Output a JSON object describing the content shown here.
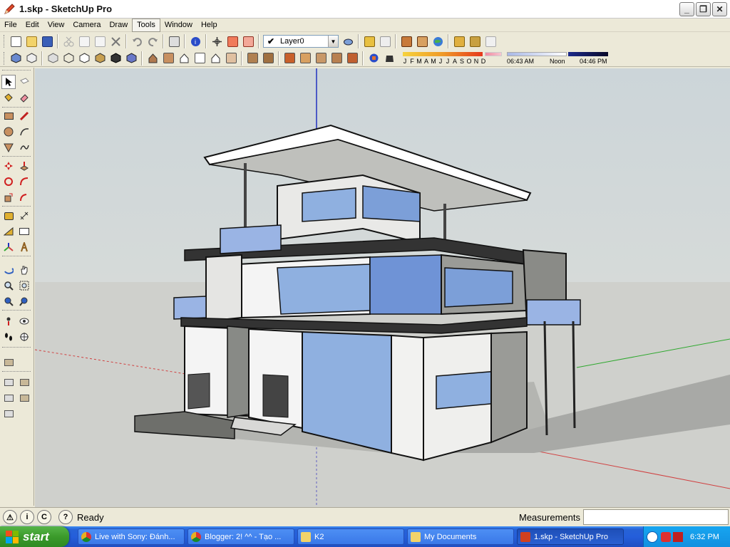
{
  "window": {
    "title": "1.skp - SketchUp Pro",
    "minimize": "_",
    "restore": "❐",
    "close": "✕"
  },
  "menu": [
    "File",
    "Edit",
    "View",
    "Camera",
    "Draw",
    "Tools",
    "Window",
    "Help"
  ],
  "menu_active": "Tools",
  "layer": {
    "check": "✔",
    "name": "Layer0",
    "arrow": "▼"
  },
  "shadow": {
    "months": [
      "J",
      "F",
      "M",
      "A",
      "M",
      "J",
      "J",
      "A",
      "S",
      "O",
      "N",
      "D"
    ],
    "time_start": "06:43 AM",
    "time_mid": "Noon",
    "time_end": "04:46 PM"
  },
  "status": {
    "icons": [
      "⚠",
      "i",
      "C",
      "?"
    ],
    "ready": "Ready",
    "measurements_label": "Measurements",
    "measurements_value": ""
  },
  "taskbar": {
    "start": "start",
    "tasks": [
      {
        "label": "Live with Sony: Đánh...",
        "icon_color": "#e8b020"
      },
      {
        "label": "Blogger: 2! ^^ - Tạo ...",
        "icon_color": "#e8b020"
      },
      {
        "label": "K2",
        "icon_color": "#f2d36a"
      },
      {
        "label": "My Documents",
        "icon_color": "#f2d36a"
      },
      {
        "label": "1.skp - SketchUp Pro",
        "icon_color": "#d04020"
      }
    ],
    "clock": "6:32 PM"
  },
  "colors": {
    "accent_blue": "#245edb",
    "start_green": "#3b9a2b",
    "glass": "#7c9fd8",
    "axis_red": "#d04040",
    "axis_green": "#2ea82e",
    "axis_blue": "#2030c0"
  }
}
